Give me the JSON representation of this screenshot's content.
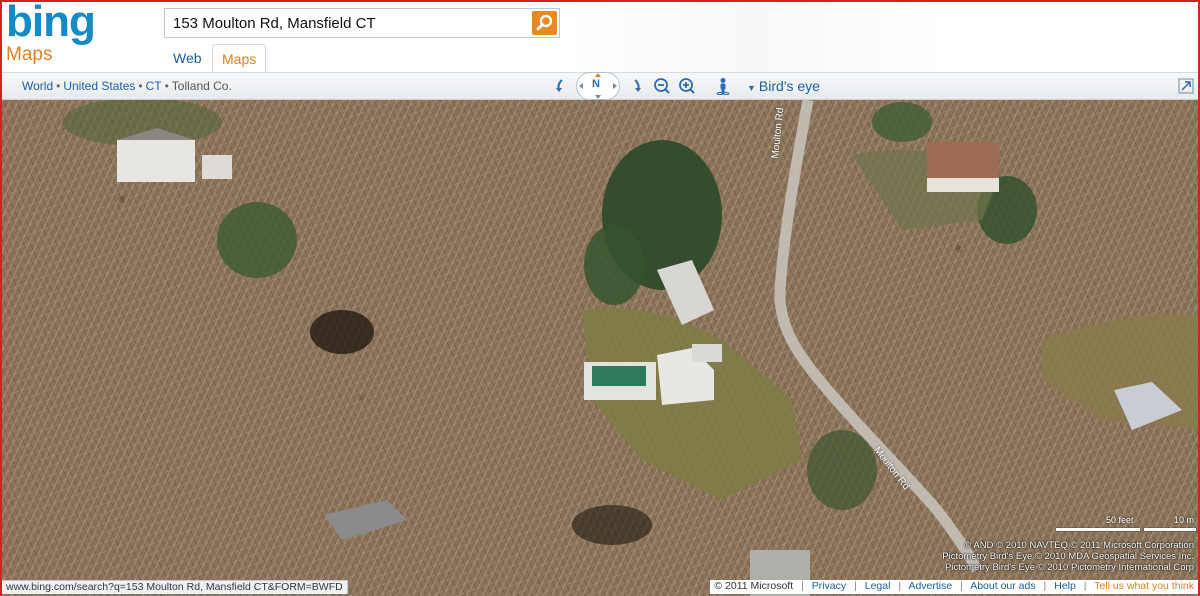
{
  "header": {
    "logo_text": "bing",
    "product_name": "Maps",
    "search_value": "153 Moulton Rd, Mansfield CT",
    "tabs": [
      {
        "label": "Web"
      },
      {
        "label": "Maps"
      }
    ]
  },
  "toolbar": {
    "breadcrumb": [
      "World",
      "United States",
      "CT",
      "Tolland Co."
    ],
    "compass_label": "N",
    "view_label": "Bird's eye"
  },
  "map": {
    "road_labels": [
      "Moulton Rd",
      "Moulton Rd"
    ],
    "scale": {
      "feet": "50 feet",
      "meters": "10 m"
    },
    "attribution": [
      "© AND   © 2010 NAVTEQ   © 2011 Microsoft Corporation",
      "Pictometry Bird's Eye © 2010 MDA Geospatial Services Inc.",
      "Pictometry Bird's Eye © 2010 Pictometry International Corp"
    ]
  },
  "status_url": "www.bing.com/search?q=153 Moulton Rd, Mansfield CT&FORM=BWFD",
  "footer": {
    "copyright": "© 2011 Microsoft",
    "links": [
      "Privacy",
      "Legal",
      "Advertise",
      "About our ads",
      "Help"
    ],
    "feedback": "Tell us what you think"
  },
  "colors": {
    "brand_blue": "#168ac5",
    "brand_orange": "#e3801c",
    "link_blue": "#1a5fa8",
    "frame_red": "#d92020"
  }
}
